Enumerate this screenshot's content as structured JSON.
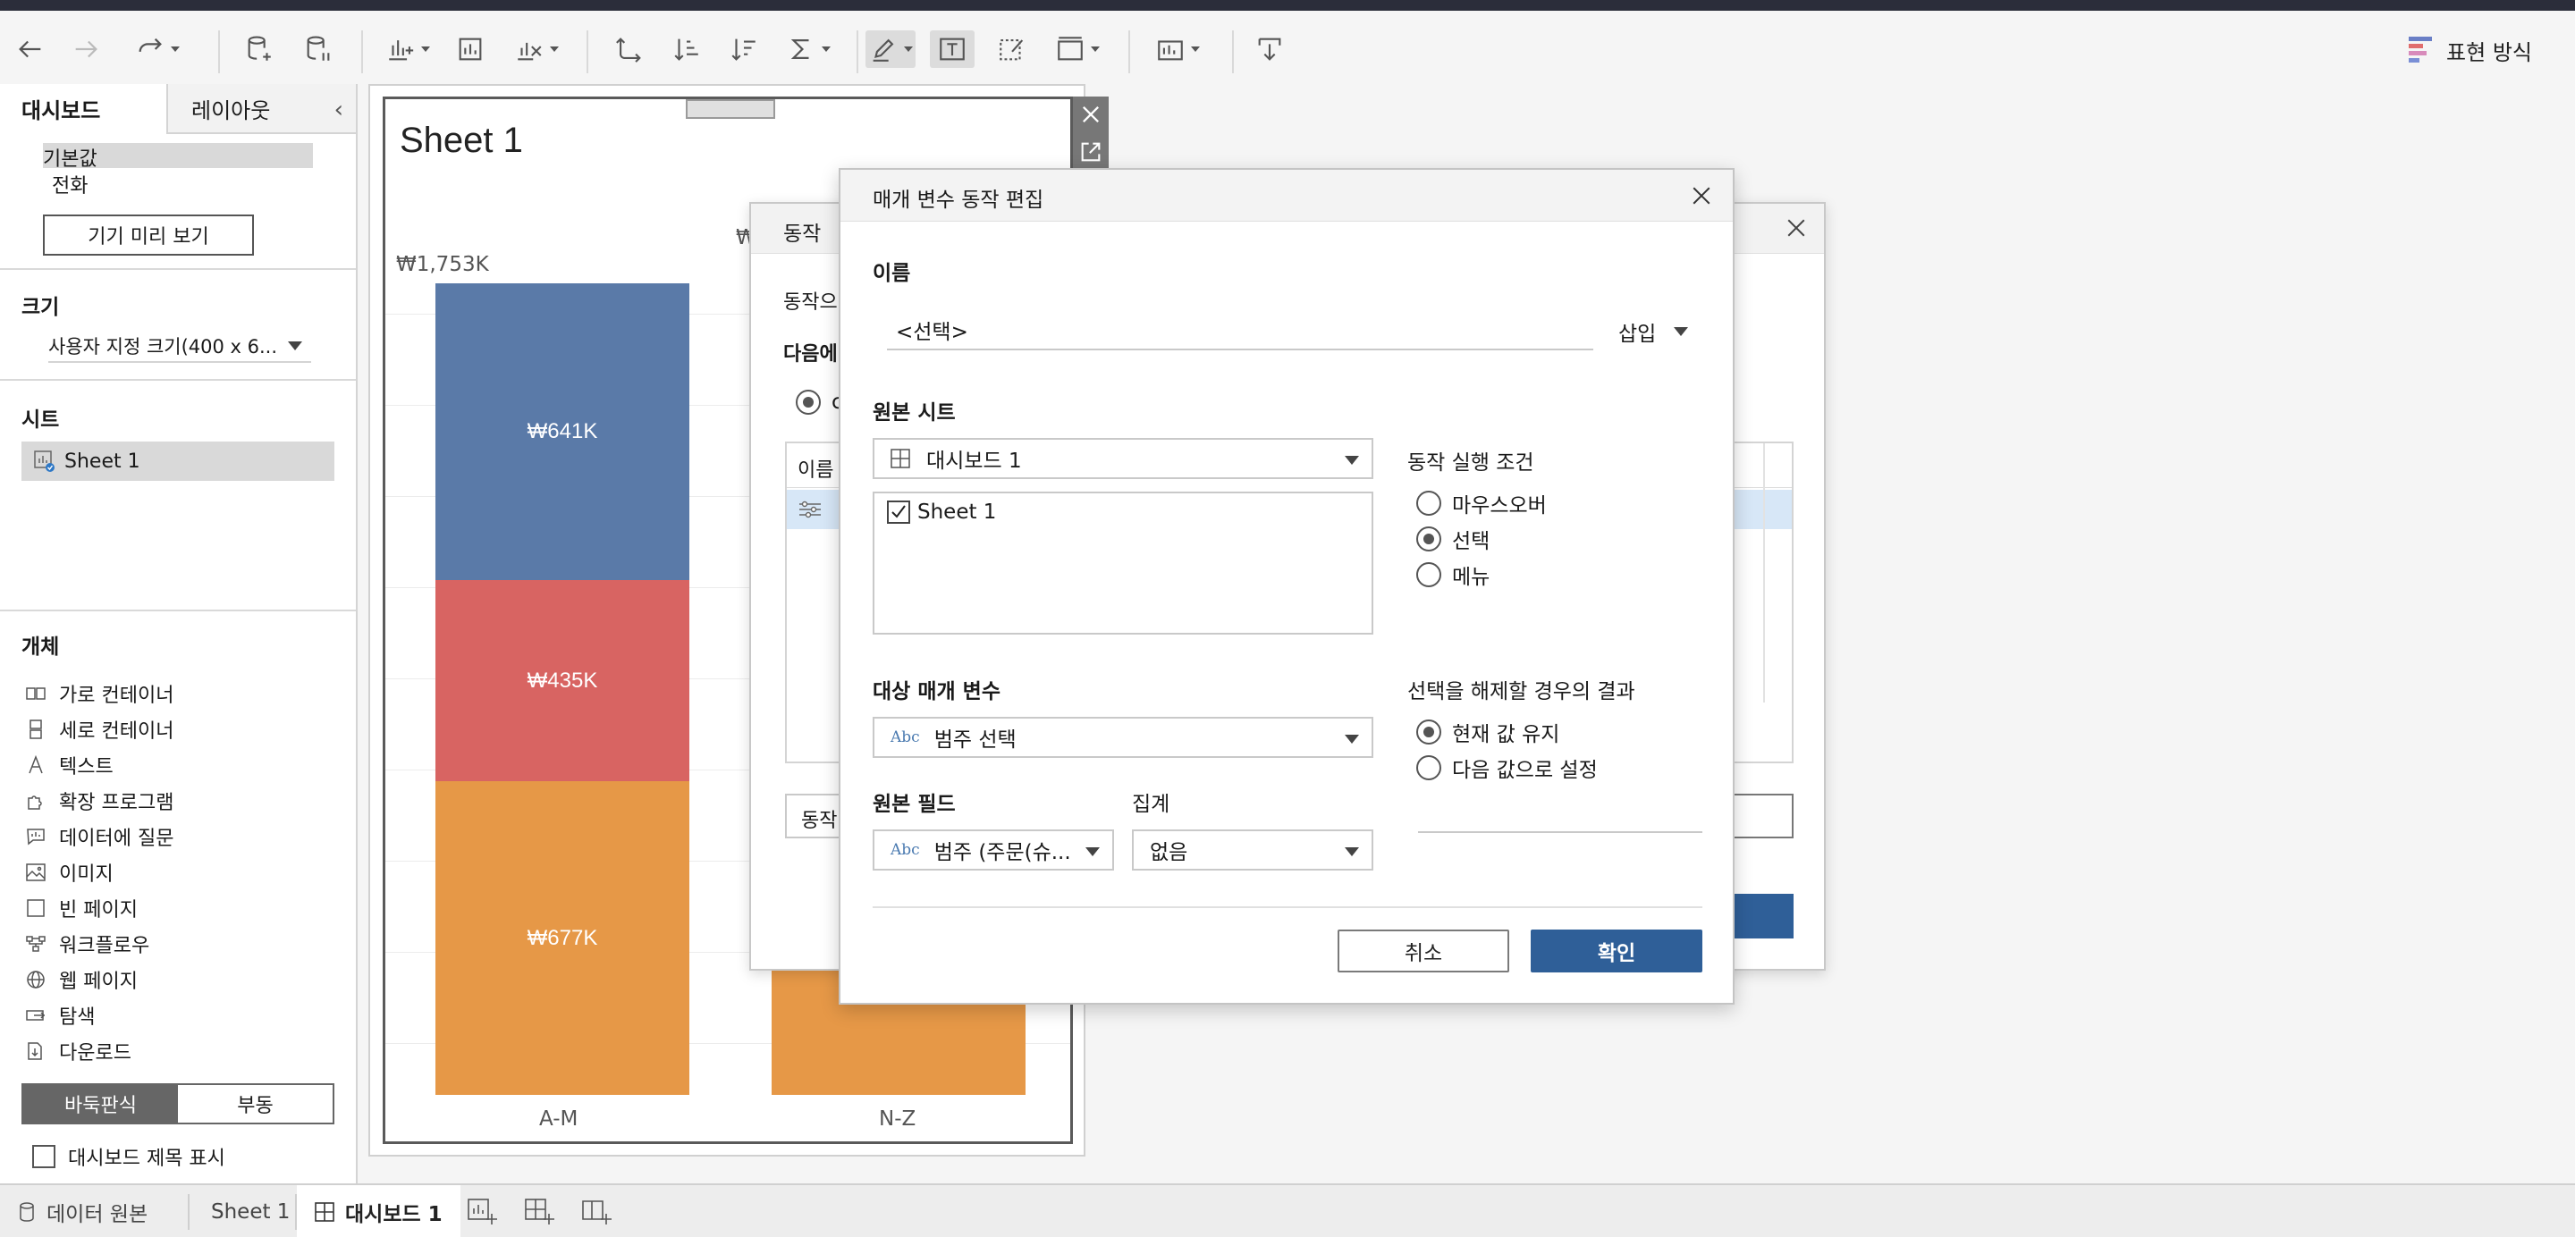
{
  "toolbar": {
    "show_me_label": "표현 방식"
  },
  "left_panel": {
    "tabs": {
      "dashboard": "대시보드",
      "layout": "레이아웃"
    },
    "device_layouts": [
      "기본값",
      "전화"
    ],
    "device_preview_button": "기기 미리 보기",
    "size_title": "크기",
    "size_value": "사용자 지정 크기(400 x 6...",
    "sheets_title": "시트",
    "sheet_item": "Sheet 1",
    "objects_title": "개체",
    "objects": [
      {
        "icon": "horizontal-container-icon",
        "label": "가로 컨테이너"
      },
      {
        "icon": "vertical-container-icon",
        "label": "세로 컨테이너"
      },
      {
        "icon": "text-icon",
        "label": "텍스트"
      },
      {
        "icon": "extension-icon",
        "label": "확장 프로그램"
      },
      {
        "icon": "ask-data-icon",
        "label": "데이터에 질문"
      },
      {
        "icon": "image-icon",
        "label": "이미지"
      },
      {
        "icon": "blank-icon",
        "label": "빈 페이지"
      },
      {
        "icon": "workflow-icon",
        "label": "워크플로우"
      },
      {
        "icon": "web-page-icon",
        "label": "웹 페이지"
      },
      {
        "icon": "navigation-icon",
        "label": "탐색"
      },
      {
        "icon": "download-icon",
        "label": "다운로드"
      }
    ],
    "tiled_label": "바둑판식",
    "floating_label": "부동",
    "show_title_label": "대시보드 제목 표시"
  },
  "sheet": {
    "title": "Sheet 1",
    "axis_top_label": "₩1,753K",
    "axis_top_label_2": "₩",
    "bars": [
      {
        "category": "A-M",
        "segments": [
          {
            "value_label": "₩641K",
            "value": 641,
            "color": "#5a7aa8"
          },
          {
            "value_label": "₩435K",
            "value": 435,
            "color": "#d86462"
          },
          {
            "value_label": "₩677K",
            "value": 677,
            "color": "#e69847"
          }
        ]
      },
      {
        "category": "N-Z",
        "segments": [
          {
            "value_label": "",
            "value": 0,
            "color": "#e69847"
          }
        ]
      }
    ]
  },
  "chart_data": {
    "type": "bar",
    "categories": [
      "A-M",
      "N-Z"
    ],
    "series": [
      {
        "values": [
          641,
          null
        ]
      },
      {
        "values": [
          435,
          null
        ]
      },
      {
        "values": [
          677,
          null
        ]
      }
    ],
    "title": "Sheet 1",
    "xlabel": "",
    "ylabel": "",
    "ylim": [
      0,
      1753
    ]
  },
  "bg_dialog": {
    "title": "동작",
    "line1": "동작으",
    "line2": "다음에",
    "radio_prefix": "c",
    "table_header": "이름",
    "add_action_label": "동작"
  },
  "dialog": {
    "title": "매개 변수 동작 편집",
    "name_label": "이름",
    "name_value": "<선택>",
    "insert_label": "삽입",
    "source_sheets_label": "원본 시트",
    "source_sheet_select": "대시보드 1",
    "sheet_checkbox_label": "Sheet 1",
    "run_action_label": "동작 실행 조건",
    "run_options": [
      "마우스오버",
      "선택",
      "메뉴"
    ],
    "run_selected": 1,
    "target_parameter_label": "대상 매개 변수",
    "target_parameter_value": "범주 선택",
    "source_field_label": "원본 필드",
    "source_field_value": "범주 (주문(슈...",
    "aggregation_label": "집계",
    "aggregation_value": "없음",
    "clearing_label": "선택을 해제할 경우의 결과",
    "clearing_options": [
      "현재 값 유지",
      "다음 값으로 설정"
    ],
    "clearing_selected": 0,
    "abc_tag": "Abc",
    "cancel_label": "취소",
    "ok_label": "확인"
  },
  "bottom_bar": {
    "data_source_label": "데이터 원본",
    "sheet_tab": "Sheet 1",
    "dashboard_tab": "대시보드 1"
  }
}
